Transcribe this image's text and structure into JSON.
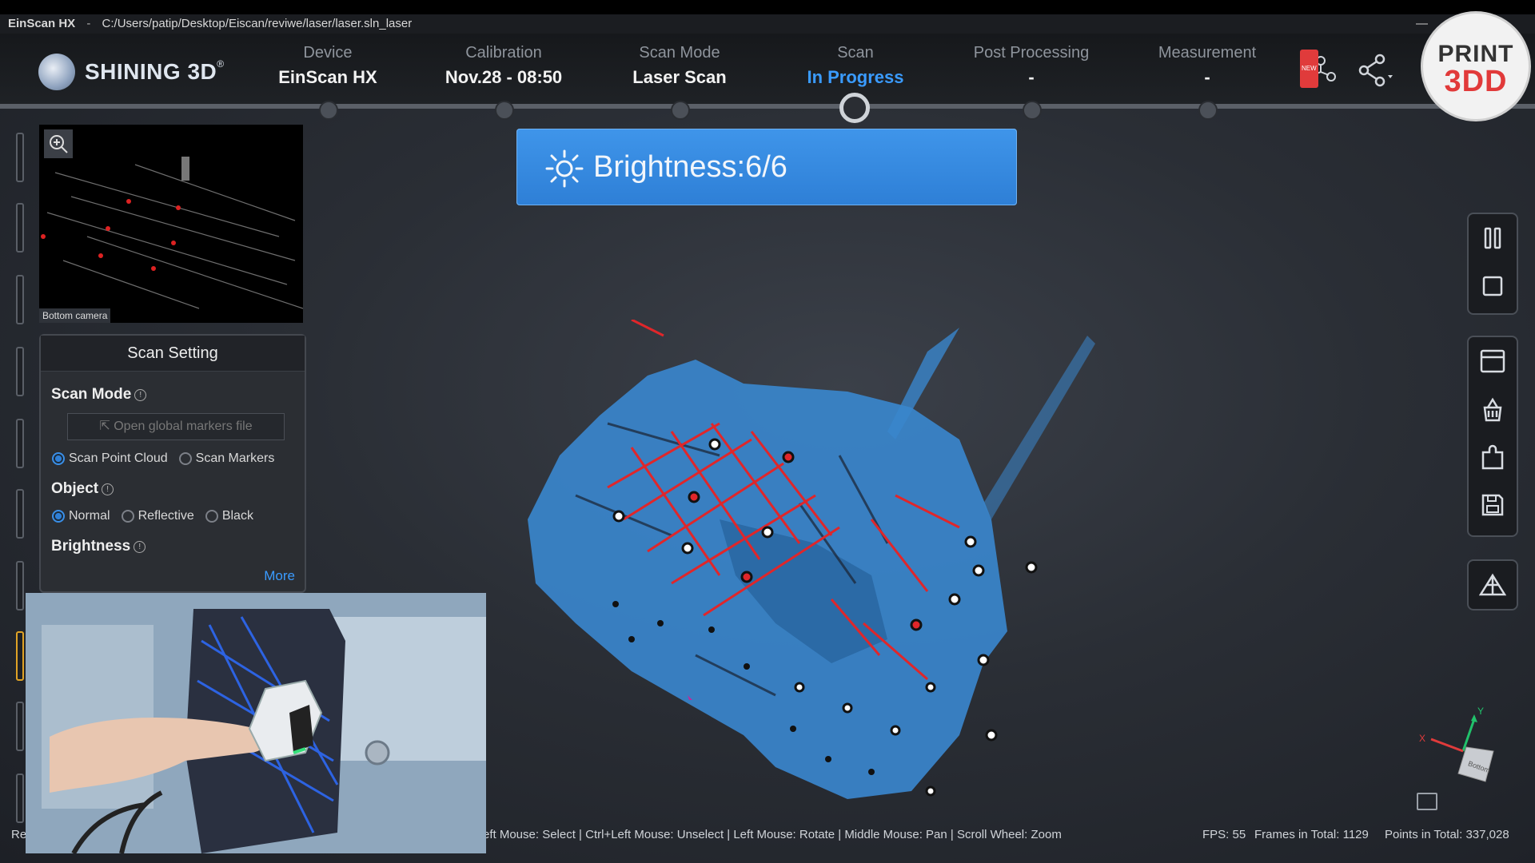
{
  "window": {
    "app_name": "EinScan HX",
    "separator": "-",
    "path": "C:/Users/patip/Desktop/Eiscan/reviwe/laser/laser.sln_laser",
    "minimize": "—"
  },
  "brand": {
    "name": "SHINING 3D",
    "reg": "®"
  },
  "steps": [
    {
      "label": "Device",
      "value": "EinScan HX"
    },
    {
      "label": "Calibration",
      "value": "Nov.28 - 08:50"
    },
    {
      "label": "Scan Mode",
      "value": "Laser Scan"
    },
    {
      "label": "Scan",
      "value": "In Progress"
    },
    {
      "label": "Post Processing",
      "value": "-"
    },
    {
      "label": "Measurement",
      "value": "-"
    }
  ],
  "header_icons": {
    "new_badge": "NEW",
    "share": "share-icon",
    "model": "model-library-icon"
  },
  "watermark": {
    "line1": "PRINT",
    "line2": "3DD"
  },
  "camera": {
    "caption": "Bottom camera"
  },
  "scan_setting": {
    "title": "Scan Setting",
    "scan_mode_label": "Scan Mode",
    "open_markers": "Open global markers file",
    "scan_mode_options": [
      "Scan Point Cloud",
      "Scan Markers"
    ],
    "scan_mode_selected": "Scan Point Cloud",
    "object_label": "Object",
    "object_options": [
      "Normal",
      "Reflective",
      "Black"
    ],
    "object_selected": "Normal",
    "brightness_label": "Brightness",
    "more": "More"
  },
  "toast": {
    "text": "Brightness:6/6"
  },
  "status": {
    "left_fragment": "Re",
    "hints": "eft Mouse: Select | Ctrl+Left Mouse: Unselect | Left Mouse: Rotate | Middle Mouse: Pan | Scroll Wheel: Zoom",
    "fps": "FPS:  55",
    "frames": "Frames in Total: 1129",
    "points": "Points in Total: 337,028"
  },
  "axis": {
    "x": "X",
    "y": "Y",
    "cube": "Bottom"
  },
  "colors": {
    "accent": "#3a9bff",
    "toast": "#2e7fd6",
    "scan_point": "#3a86cc",
    "laser_line": "#e0262a"
  }
}
